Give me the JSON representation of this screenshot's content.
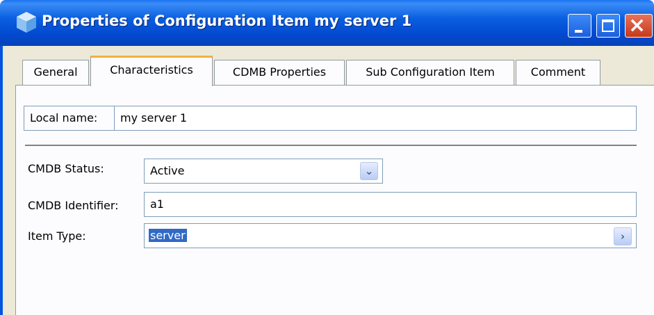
{
  "window": {
    "title": "Properties of Configuration Item my server 1",
    "icon": "cube-icon",
    "controls": [
      "minimize",
      "maximize",
      "close"
    ],
    "close_glyph": "×",
    "colors": {
      "titlebar": "#0454e0",
      "panel": "#fcfcfe",
      "tab_highlight": "#f4b040",
      "selection": "#316ac5"
    }
  },
  "tabs": [
    {
      "label": "General",
      "active": false
    },
    {
      "label": "Characteristics",
      "active": true
    },
    {
      "label": "CDMB Properties",
      "active": false
    },
    {
      "label": "Sub Configuration Item",
      "active": false
    },
    {
      "label": "Comment",
      "active": false
    }
  ],
  "form": {
    "local_name": {
      "label": "Local name:",
      "value": "my server 1"
    },
    "cmdb_status": {
      "label": "CMDB Status:",
      "value": "Active",
      "button_glyph": "⌄"
    },
    "cmdb_identifier": {
      "label": "CMDB Identifier:",
      "value": "a1"
    },
    "item_type": {
      "label": "Item Type:",
      "value": "server",
      "button_glyph": "›"
    }
  }
}
